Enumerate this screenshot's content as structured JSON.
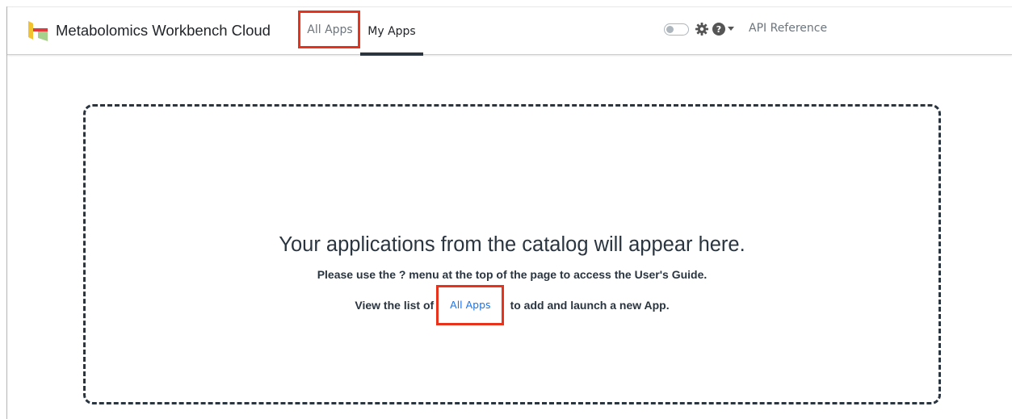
{
  "navbar": {
    "brand_name": "Metabolomics Workbench Cloud",
    "tabs": [
      {
        "label": "All Apps",
        "active": false,
        "highlighted": true
      },
      {
        "label": "My Apps",
        "active": true
      }
    ],
    "theme_toggle_on": false,
    "settings_icon": "gear-icon",
    "help_icon": "question-circle-icon",
    "api_reference_label": "API Reference"
  },
  "empty_state": {
    "headline": "Your applications from the catalog will appear here.",
    "help_text": "Please use the ? menu at the top of the page to access the User's Guide.",
    "prefix": "View the list of",
    "link_label": "All Apps",
    "suffix": "to add and launch a new App."
  },
  "colors": {
    "highlight": "#e8331c",
    "active_tab_underline": "#2a3540",
    "link": "#1a73e8",
    "dashed_border": "#2a3540"
  }
}
